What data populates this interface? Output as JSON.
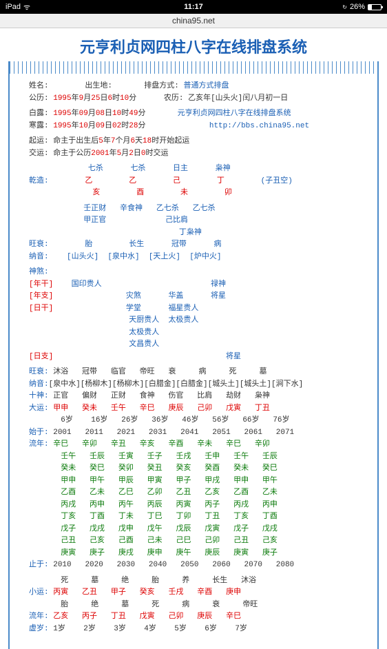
{
  "status": {
    "device": "iPad",
    "wifi": "ᯤ",
    "time": "11:17",
    "battery_pct": "26%"
  },
  "url": "china95.net",
  "title": "元亨利贞网四柱八字在线排盘系统",
  "info": {
    "name_label": "姓名:",
    "born_label": "出生地:",
    "pai_label": "排盘方式:",
    "pai_val": "普通方式排盘",
    "gl_label": "公历:",
    "gl_val_pre": "1995",
    "gl_y": "年",
    "gl_m": "9",
    "gl_ml": "月",
    "gl_d": "25",
    "gl_dl": "日",
    "gl_h": "6",
    "gl_hl": "时",
    "gl_mi": "10",
    "gl_mil": "分",
    "nl_label": "农历:",
    "nl_val": "乙亥年[山头火]闰八月初一日",
    "bl_label": "白露:",
    "bl_val_pre": "1995",
    "bl_m": "09",
    "bl_d": "08",
    "bl_h": "10",
    "bl_mi": "49",
    "system_name": "元亨利贞网四柱八字在线排盘系统",
    "hl_label": "寒露:",
    "hl_val_pre": "1995",
    "hl_m": "10",
    "hl_d": "09",
    "hl_h": "02",
    "hl_mi": "28",
    "site_url": "http://bbs.china95.net",
    "qy_label": "起运:",
    "qy_text_1": "命主于出生后",
    "qy_y": "5",
    "qy_yl": "年",
    "qy_mo": "7",
    "qy_mol": "个月",
    "qy_d": "6",
    "qy_dl": "天",
    "qy_h": "18",
    "qy_hl": "时开始起运",
    "jy_label": "交运:",
    "jy_text_1": "命主于公历",
    "jy_y": "2001",
    "jy_yl": "年",
    "jy_m": "5",
    "jy_ml": "月",
    "jy_d": "2",
    "jy_dl": "日",
    "jy_h": "0",
    "jy_hl": "时交运"
  },
  "bazi": {
    "ten_gods": [
      "七杀",
      "七杀",
      "日主",
      "枭神"
    ],
    "qz_label": "乾造:",
    "gan": [
      "乙",
      "乙",
      "己",
      "丁"
    ],
    "kong": "(子丑空)",
    "zhi": [
      "亥",
      "酉",
      "未",
      "卯"
    ],
    "canggan": [
      [
        "壬正财",
        "辛食神",
        "乙七杀",
        "乙七杀"
      ],
      [
        "甲正官",
        "",
        "己比肩",
        ""
      ],
      [
        "",
        "",
        "丁枭神",
        ""
      ]
    ],
    "ws_label": "旺衰:",
    "ws": [
      "胎",
      "长生",
      "冠带",
      "病"
    ],
    "ny_label": "纳音:",
    "ny": [
      "[山头火]",
      "[泉中水]",
      "[天上火]",
      "[炉中火]"
    ],
    "ss_label": "神煞:",
    "ng_label": "[年干]",
    "ng_val": [
      "国印贵人",
      "",
      "",
      "禄神"
    ],
    "nz_label": "[年支]",
    "nz_val": [
      "",
      "灾煞",
      "华盖",
      "将星"
    ],
    "rg_label": "[日干]",
    "rg_rows": [
      [
        "",
        "学堂",
        "福星贵人",
        ""
      ],
      [
        "",
        "天厨贵人",
        "太极贵人",
        ""
      ],
      [
        "",
        "太极贵人",
        "",
        ""
      ],
      [
        "",
        "文昌贵人",
        "",
        ""
      ]
    ],
    "rz_label": "[日支]",
    "rz_val": [
      "",
      "",
      "",
      "将星"
    ]
  },
  "wangshuai": {
    "label": "旺衰:",
    "vals": [
      "沐浴",
      "冠带",
      "临官",
      "帝旺",
      "衰",
      "病",
      "死",
      "墓"
    ],
    "nayin_label": "纳音:",
    "nayin": "[泉中水][杨柳木][杨柳木][白腊金][白腊金][城头土][城头土][涧下水]",
    "shishen_label": "十神:",
    "shishen": [
      "正官",
      "偏财",
      "正财",
      "食神",
      "伤官",
      "比肩",
      "劫财",
      "枭神"
    ],
    "dy_label": "大运:",
    "dy": [
      "甲申",
      "癸未",
      "壬午",
      "辛巳",
      "庚辰",
      "己卯",
      "戊寅",
      "丁丑"
    ],
    "ages": [
      "6岁",
      "16岁",
      "26岁",
      "36岁",
      "46岁",
      "56岁",
      "66岁",
      "76岁"
    ],
    "sy_label": "始于:",
    "sy": [
      "2001",
      "2011",
      "2021",
      "2031",
      "2041",
      "2051",
      "2061",
      "2071"
    ]
  },
  "liunian": {
    "label": "流年:",
    "rows": [
      [
        "辛巳",
        "辛卯",
        "辛丑",
        "辛亥",
        "辛酉",
        "辛未",
        "辛巳",
        "辛卯"
      ],
      [
        "壬午",
        "壬辰",
        "壬寅",
        "壬子",
        "壬戌",
        "壬申",
        "壬午",
        "壬辰"
      ],
      [
        "癸未",
        "癸巳",
        "癸卯",
        "癸丑",
        "癸亥",
        "癸酉",
        "癸未",
        "癸巳"
      ],
      [
        "甲申",
        "甲午",
        "甲辰",
        "甲寅",
        "甲子",
        "甲戌",
        "甲申",
        "甲午"
      ],
      [
        "乙酉",
        "乙未",
        "乙巳",
        "乙卯",
        "乙丑",
        "乙亥",
        "乙酉",
        "乙未"
      ],
      [
        "丙戌",
        "丙申",
        "丙午",
        "丙辰",
        "丙寅",
        "丙子",
        "丙戌",
        "丙申"
      ],
      [
        "丁亥",
        "丁酉",
        "丁未",
        "丁巳",
        "丁卯",
        "丁丑",
        "丁亥",
        "丁酉"
      ],
      [
        "戊子",
        "戊戌",
        "戊申",
        "戊午",
        "戊辰",
        "戊寅",
        "戊子",
        "戊戌"
      ],
      [
        "己丑",
        "己亥",
        "己酉",
        "己未",
        "己巳",
        "己卯",
        "己丑",
        "己亥"
      ],
      [
        "庚寅",
        "庚子",
        "庚戌",
        "庚申",
        "庚午",
        "庚辰",
        "庚寅",
        "庚子"
      ]
    ],
    "zy_label": "止于:",
    "zy": [
      "2010",
      "2020",
      "2030",
      "2040",
      "2050",
      "2060",
      "2070",
      "2080"
    ]
  },
  "xiaoyun": {
    "top": [
      "死",
      "墓",
      "绝",
      "胎",
      "养",
      "长生",
      "沐浴"
    ],
    "label": "小运:",
    "vals": [
      "丙寅",
      "乙丑",
      "甲子",
      "癸亥",
      "壬戌",
      "辛酉",
      "庚申"
    ],
    "mid": [
      "胎",
      "绝",
      "墓",
      "死",
      "病",
      "衰",
      "帝旺"
    ],
    "ln_label": "流年:",
    "ln": [
      "乙亥",
      "丙子",
      "丁丑",
      "戊寅",
      "己卯",
      "庚辰",
      "辛巳"
    ],
    "xs_label": "虚岁:",
    "xs": [
      "1岁",
      "2岁",
      "3岁",
      "4岁",
      "5岁",
      "6岁",
      "7岁"
    ]
  }
}
